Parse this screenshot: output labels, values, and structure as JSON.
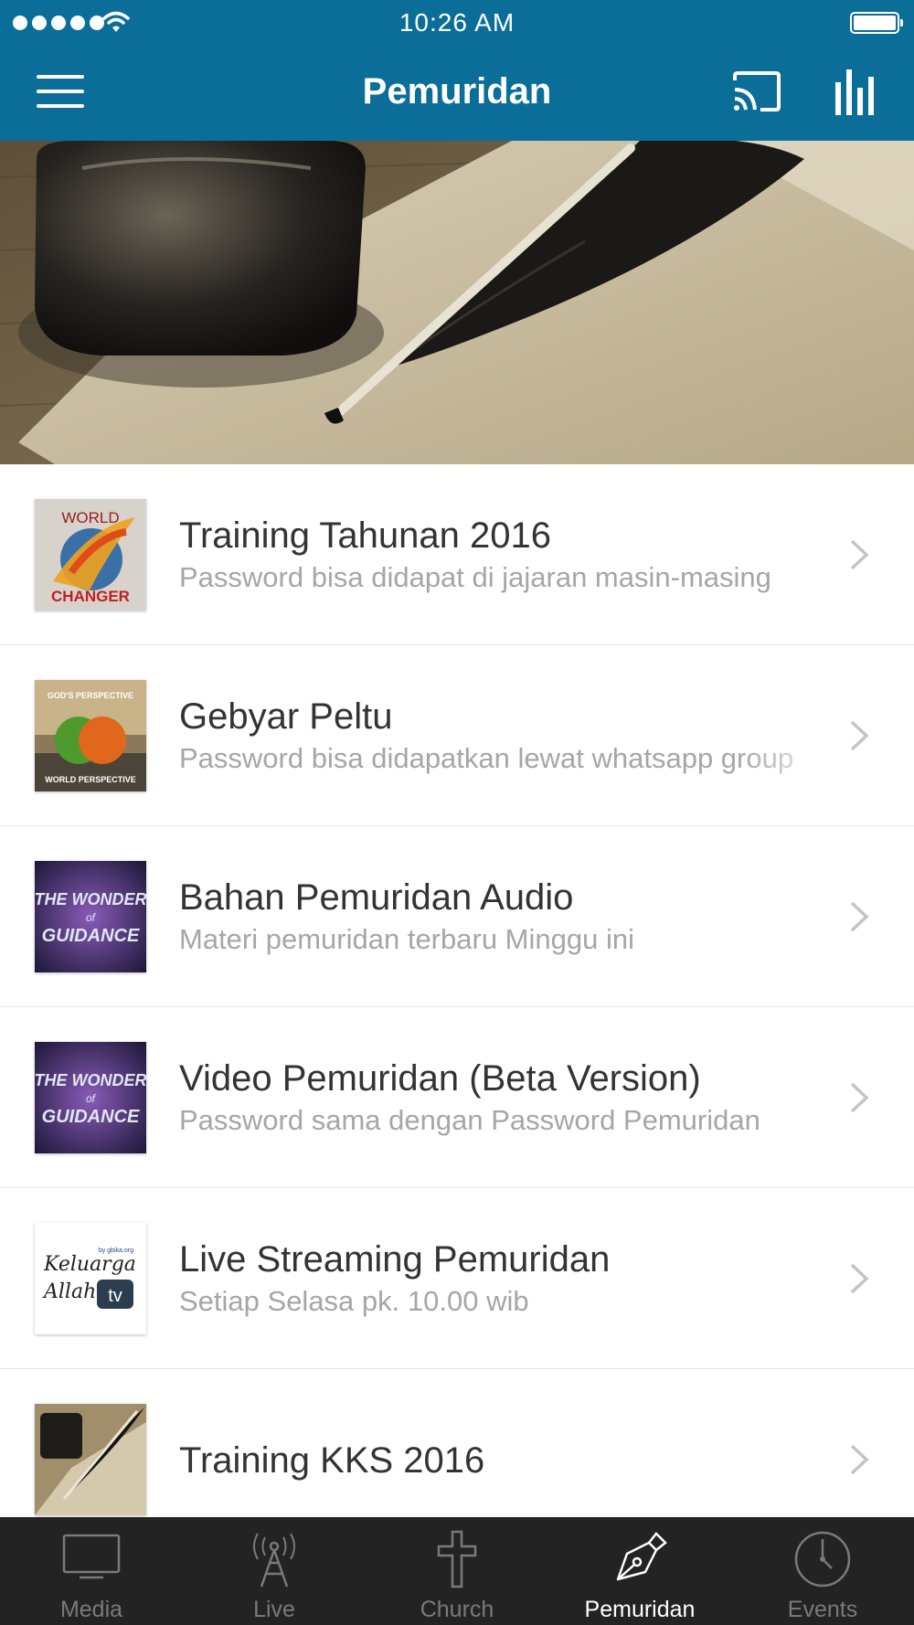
{
  "status_bar": {
    "time": "10:26 AM"
  },
  "header": {
    "title": "Pemuridan",
    "icons": [
      "menu-icon",
      "cast-icon",
      "stats-icon"
    ]
  },
  "hero": {
    "image": "inkwell-and-quill-photo"
  },
  "items": [
    {
      "title": "Training Tahunan 2016",
      "subtitle": "Password bisa didapat di jajaran masin-masing",
      "thumb_text": [
        "WORLD",
        "CHANGER"
      ]
    },
    {
      "title": "Gebyar Peltu",
      "subtitle": "Password bisa didapatkan lewat whatsapp group",
      "thumb_text": [
        "GOD'S PERSPECTIVE",
        "WORLD PERSPECTIVE"
      ]
    },
    {
      "title": "Bahan Pemuridan Audio",
      "subtitle": "Materi pemuridan terbaru Minggu ini",
      "thumb_text": [
        "THE WONDER",
        "of",
        "GUIDANCE"
      ]
    },
    {
      "title": "Video Pemuridan (Beta Version)",
      "subtitle": "Password sama dengan Password Pemuridan",
      "thumb_text": [
        "THE WONDER",
        "of",
        "GUIDANCE"
      ]
    },
    {
      "title": "Live Streaming Pemuridan",
      "subtitle": "Setiap Selasa pk. 10.00 wib",
      "thumb_text": [
        "by gbika.org",
        "Keluarga",
        "Allah",
        "tv"
      ]
    },
    {
      "title": "Training KKS 2016",
      "subtitle": ""
    }
  ],
  "tabs": [
    {
      "label": "Media",
      "icon": "tv-icon",
      "active": false
    },
    {
      "label": "Live",
      "icon": "antenna-icon",
      "active": false
    },
    {
      "label": "Church",
      "icon": "cross-icon",
      "active": false
    },
    {
      "label": "Pemuridan",
      "icon": "pen-icon",
      "active": true
    },
    {
      "label": "Events",
      "icon": "clock-icon",
      "active": false
    }
  ],
  "colors": {
    "header": "#0a6e98",
    "tabbar": "#232323",
    "tab_active": "#ffffff",
    "tab_inactive": "#7a7a7a"
  }
}
